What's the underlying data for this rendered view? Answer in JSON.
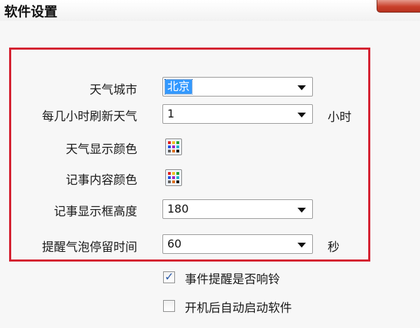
{
  "window": {
    "title": "软件设置"
  },
  "settings": {
    "city": {
      "label": "天气城市",
      "value": "北京"
    },
    "refresh": {
      "label": "每几小时刷新天气",
      "value": "1",
      "unit": "小时"
    },
    "weather_color": {
      "label": "天气显示颜色"
    },
    "note_color": {
      "label": "记事内容颜色"
    },
    "box_height": {
      "label": "记事显示框高度",
      "value": "180"
    },
    "bubble_time": {
      "label": "提醒气泡停留时间",
      "value": "60",
      "unit": "秒"
    }
  },
  "options": {
    "ring": {
      "label": "事件提醒是否响铃",
      "checked": true
    },
    "autostart": {
      "label": "开机后自动启动软件",
      "checked": false
    }
  },
  "colors": {
    "highlight_border": "#d42030",
    "selection": "#3399ff",
    "close_button": "#c9412c"
  },
  "icons": {
    "color_picker": "palette-grid-icon",
    "dropdown": "chevron-down-icon",
    "close": "close-icon"
  }
}
